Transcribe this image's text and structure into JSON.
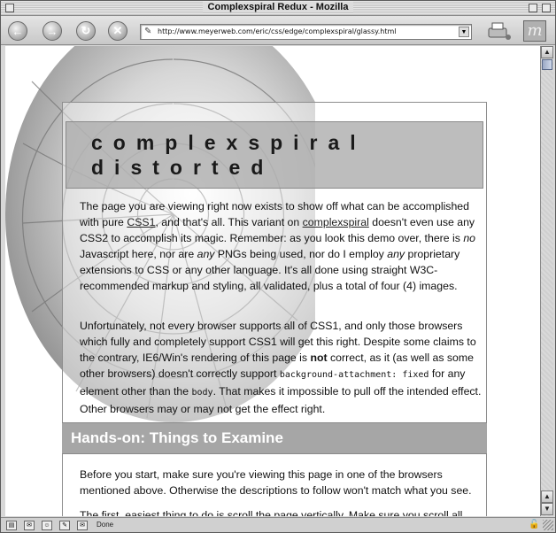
{
  "window": {
    "title": "Complexspiral Redux - Mozilla"
  },
  "toolbar": {
    "url": "http://www.meyerweb.com/eric/css/edge/complexspiral/glassy.html"
  },
  "page": {
    "header_line1": "complexspiral",
    "header_line2": "distorted",
    "p1": {
      "t1": "The page you are viewing right now exists to show off what can be accomplished with pure ",
      "link1": "CSS1",
      "t2": ", and that's all. This variant on ",
      "link2": "complexspiral",
      "t3": " doesn't even use any CSS2 to accomplish its magic. Remember: as you look this demo over, there is ",
      "em1": "no",
      "t4": " Javascript here, nor are ",
      "em2": "any",
      "t5": " PNGs being used, nor do I employ ",
      "em3": "any",
      "t6": " proprietary extensions to CSS or any other language. It's all done using straight W3C-recommended markup and styling, all validated, plus a total of four (4) images."
    },
    "p2": {
      "t1": "Unfortunately, not every browser supports all of CSS1, and only those browsers which fully and completely support CSS1 will get this right. Despite some claims to the contrary, IE6/Win's rendering of this page is ",
      "strong": "not",
      "t2": " correct, as it (as well as some other browsers) doesn't correctly support ",
      "code1": "background-attachment: fixed",
      "t3": " for any element other than the ",
      "code2": "body",
      "t4": ". That makes it impossible to pull off the intended effect. Other browsers may or may not get the effect right."
    },
    "h2": "Hands-on: Things to Examine",
    "p3": "Before you start, make sure you're viewing this page in one of the browsers mentioned above. Otherwise the descriptions to follow won't match what you see.",
    "p4": "The first, easiest thing to do is scroll the page vertically. Make sure you scroll all"
  },
  "status": {
    "text": "Done"
  },
  "icons": {
    "back": "back-arrow-icon",
    "forward": "forward-arrow-icon",
    "reload": "reload-icon",
    "stop": "stop-icon",
    "print": "print-icon",
    "throbber": "mozilla-logo-icon"
  }
}
